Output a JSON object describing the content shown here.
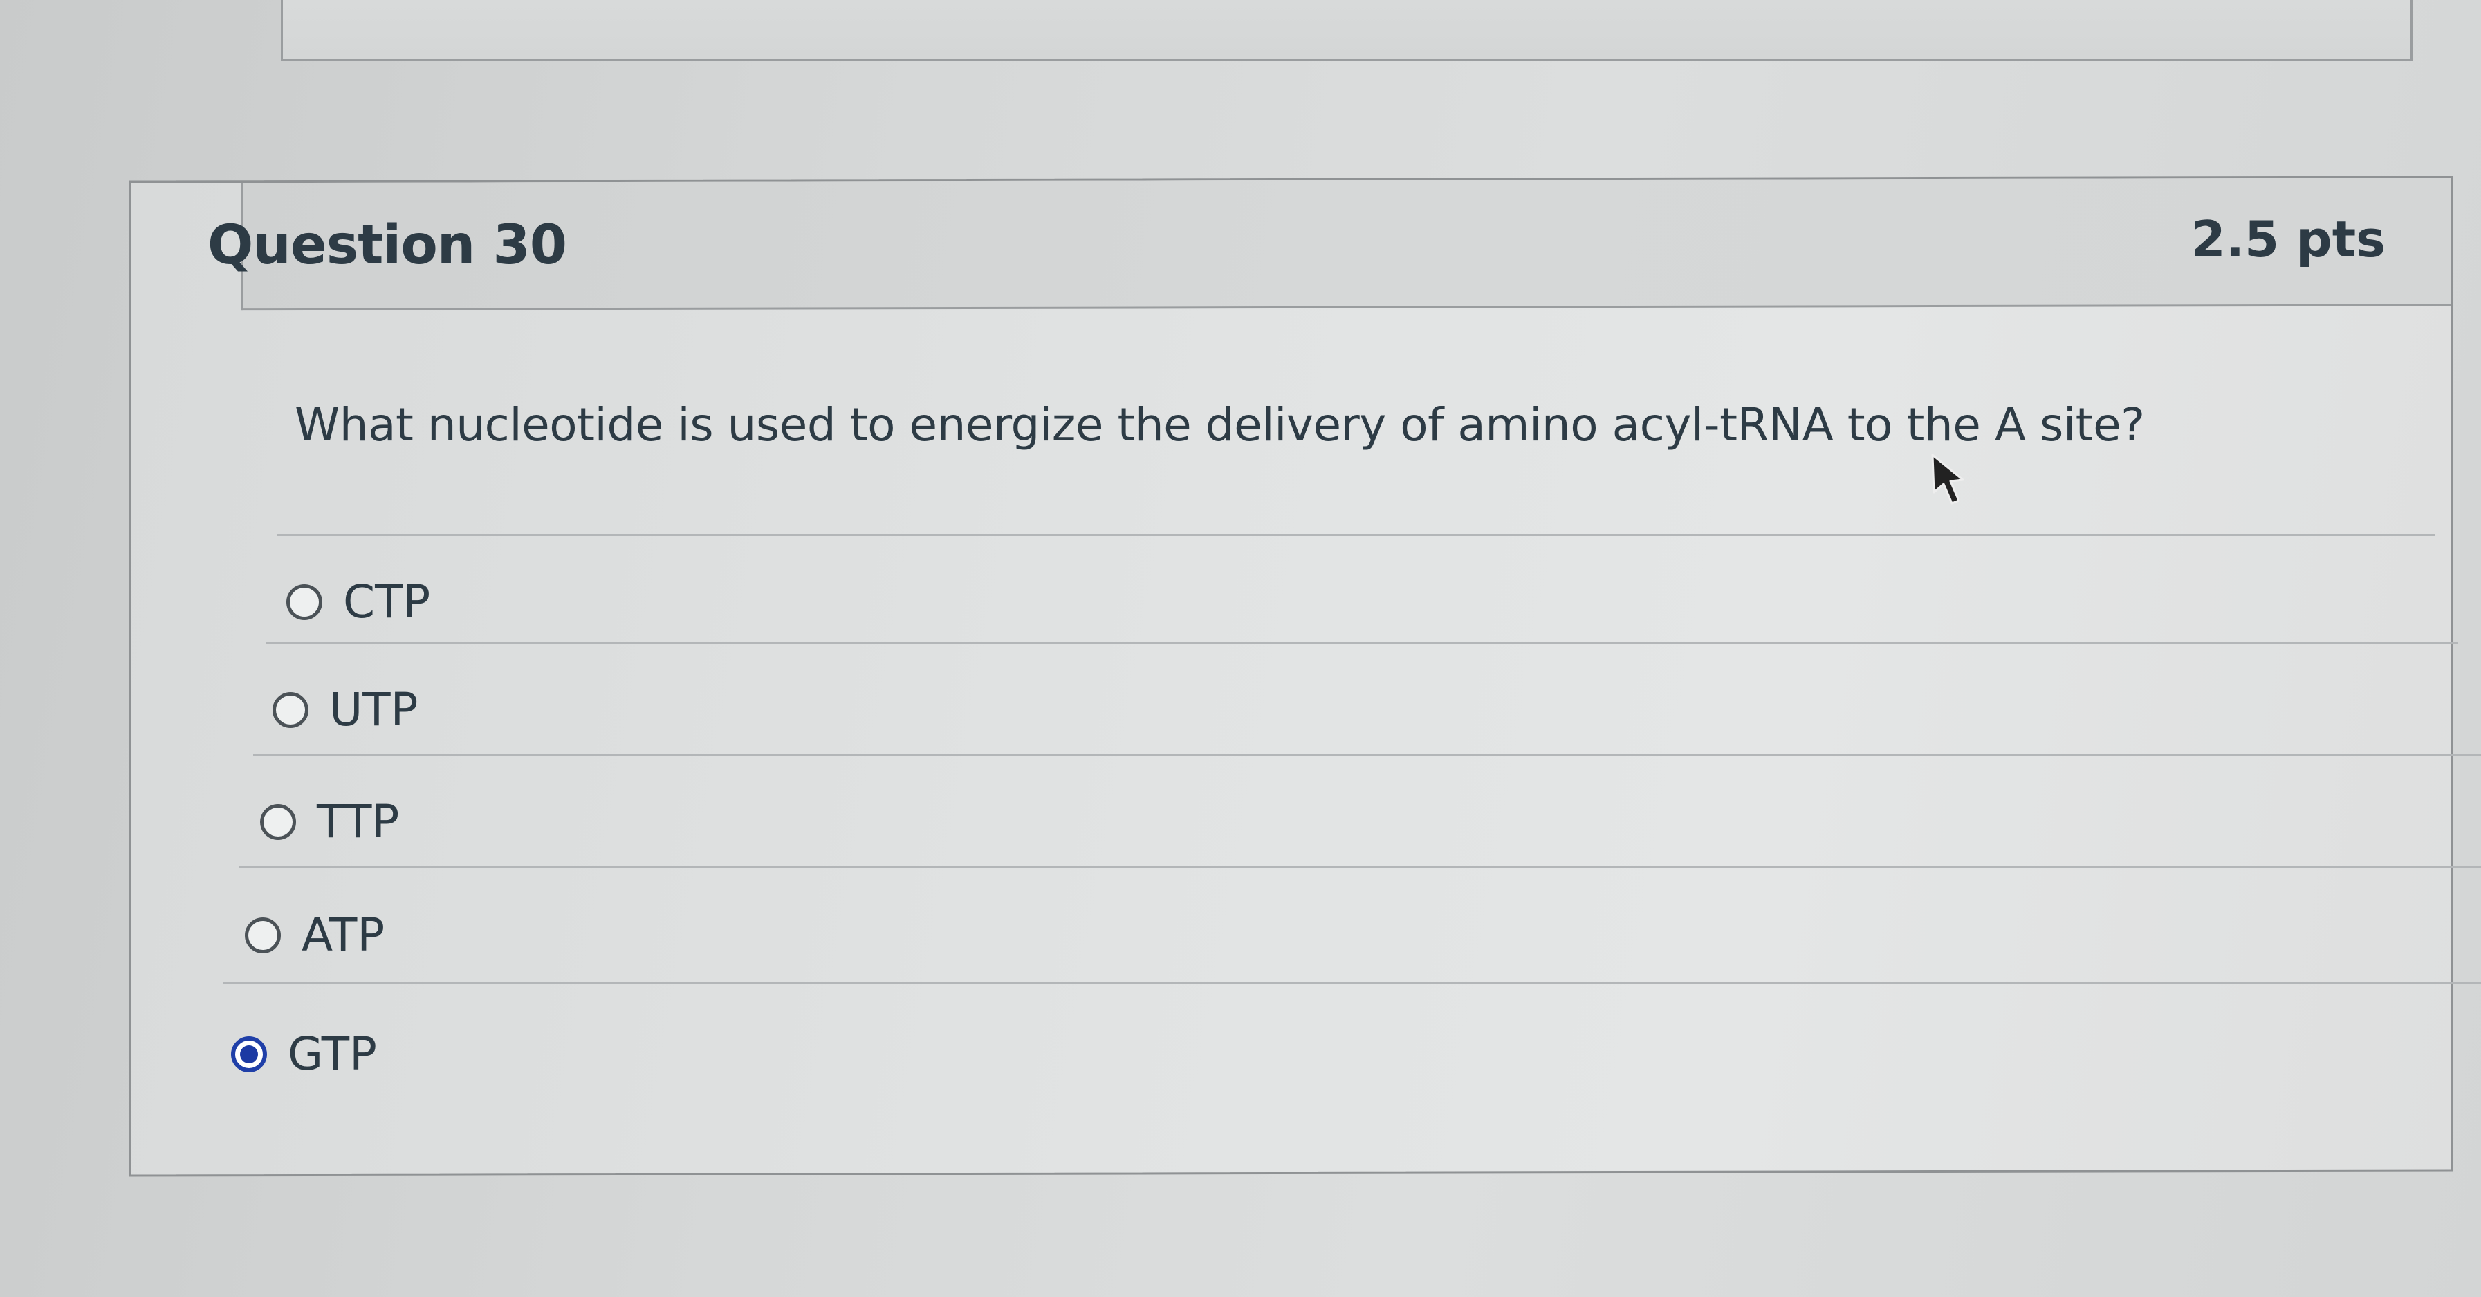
{
  "question": {
    "title": "Question 30",
    "points": "2.5 pts",
    "text": "What nucleotide is used to energize the delivery of amino acyl-tRNA to the A site?",
    "flag_icon": "flag-outline-icon"
  },
  "answers": [
    {
      "label": "CTP",
      "selected": false
    },
    {
      "label": "UTP",
      "selected": false
    },
    {
      "label": "TTP",
      "selected": false
    },
    {
      "label": "ATP",
      "selected": false
    },
    {
      "label": "GTP",
      "selected": true
    }
  ],
  "colors": {
    "text": "#2d3b45",
    "radio_selected": "#1c3aa3",
    "border": "#8f9294"
  }
}
